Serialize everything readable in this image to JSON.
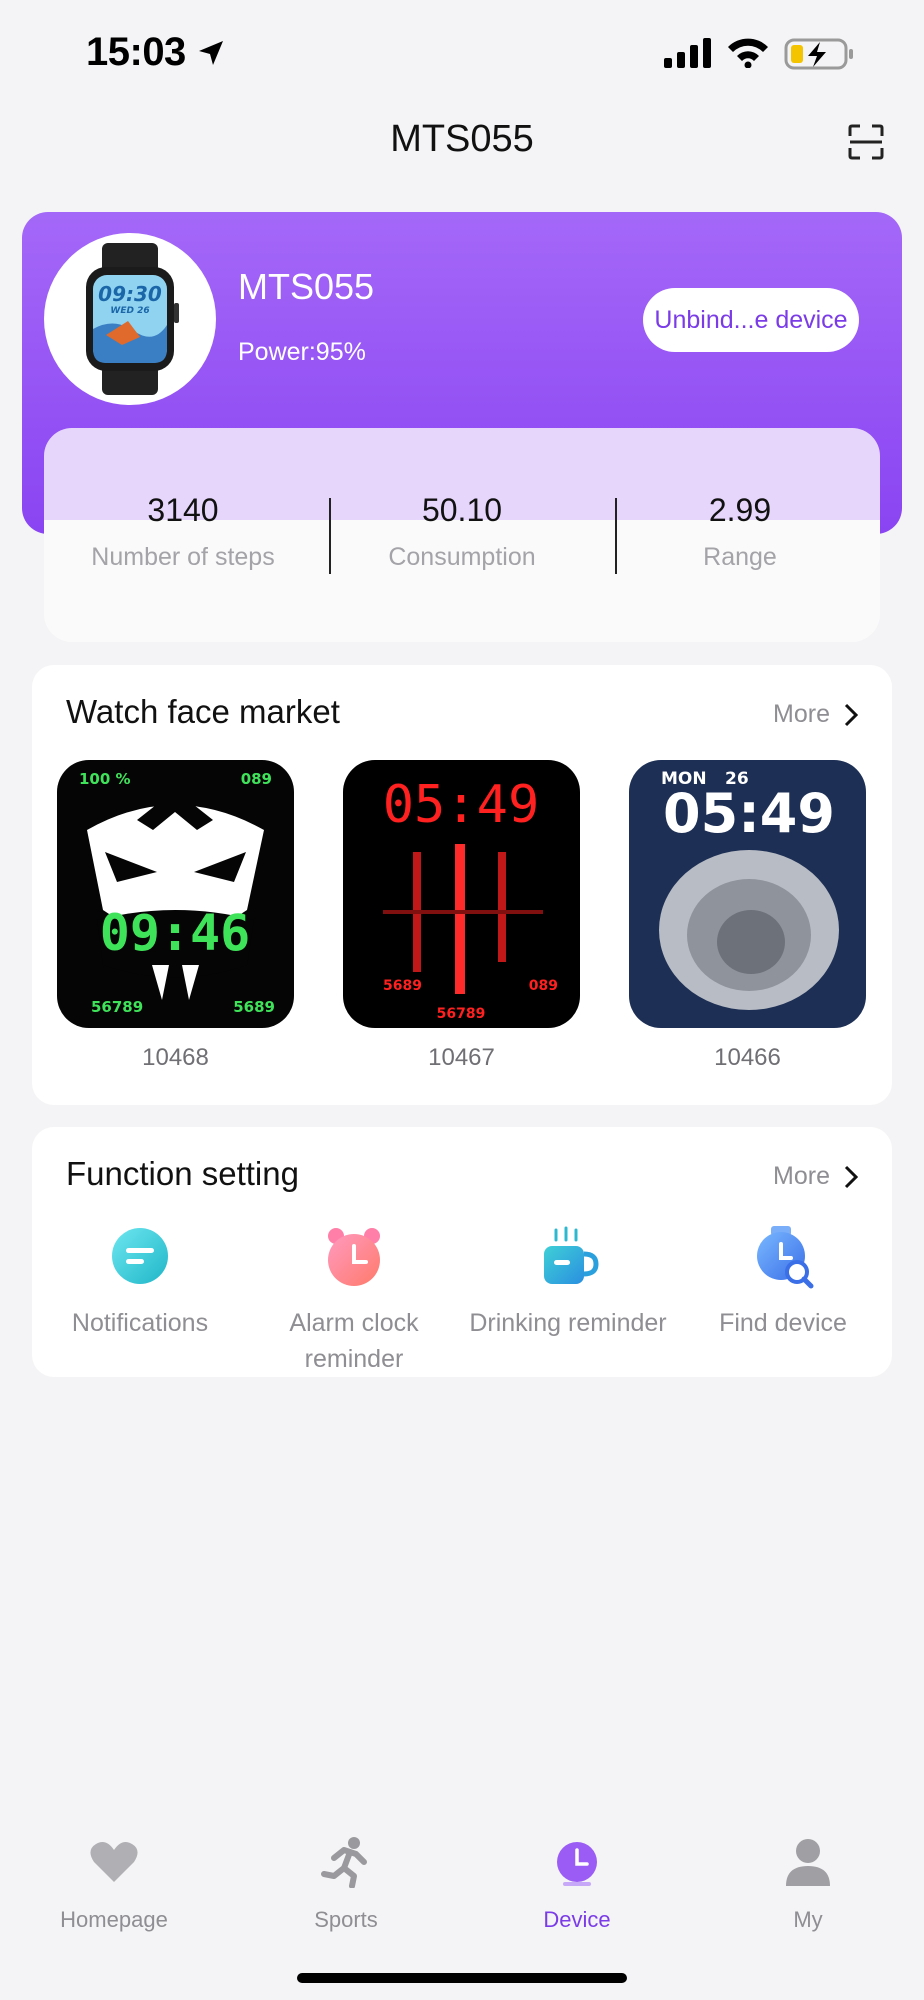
{
  "status_bar": {
    "time": "15:03"
  },
  "header": {
    "title": "MTS055"
  },
  "device": {
    "name": "MTS055",
    "power": "Power:95%",
    "unbind_label": "Unbind...e device",
    "watch_time": "09:30",
    "watch_date": "WED 26"
  },
  "stats": [
    {
      "value": "3140",
      "label": "Number of steps"
    },
    {
      "value": "50.10",
      "label": "Consumption"
    },
    {
      "value": "2.99",
      "label": "Range"
    }
  ],
  "watch_faces": {
    "title": "Watch face market",
    "more_label": "More",
    "items": [
      {
        "id": "10468",
        "battery": "100 %",
        "heart": "089",
        "time": "09:46",
        "steps": "56789",
        "calories": "5689"
      },
      {
        "id": "10467",
        "time": "05:49",
        "calories": "5689",
        "heart": "089",
        "steps": "56789"
      },
      {
        "id": "10466",
        "day": "MON",
        "date": "26",
        "time": "05:49"
      }
    ]
  },
  "functions": {
    "title": "Function setting",
    "more_label": "More",
    "items": [
      {
        "label": "Notifications",
        "icon": "chat-bubble-icon"
      },
      {
        "label": "Alarm clock reminder",
        "icon": "alarm-clock-icon"
      },
      {
        "label": "Drinking reminder",
        "icon": "coffee-cup-icon"
      },
      {
        "label": "Find device",
        "icon": "watch-search-icon"
      }
    ]
  },
  "tabs": [
    {
      "label": "Homepage",
      "icon": "heart-icon"
    },
    {
      "label": "Sports",
      "icon": "runner-icon"
    },
    {
      "label": "Device",
      "icon": "clock-icon",
      "active": true
    },
    {
      "label": "My",
      "icon": "person-icon"
    }
  ],
  "colors": {
    "accent": "#7b3ce8",
    "card_gradient_top": "#a468f8",
    "card_gradient_bottom": "#8a44f2"
  }
}
